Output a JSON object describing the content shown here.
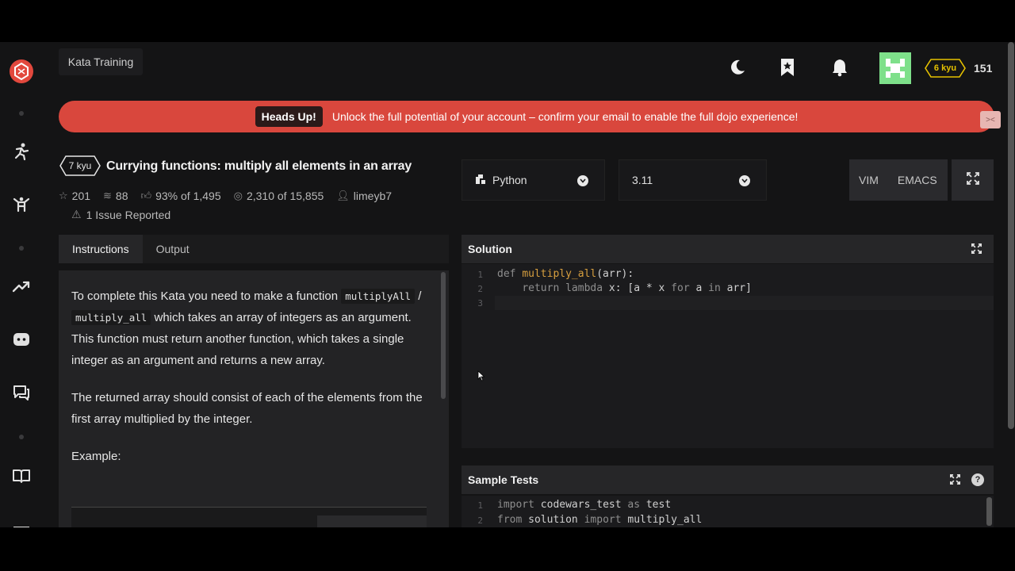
{
  "topbar": {
    "title": "Kata Training",
    "rank": "6 kyu",
    "honor": "151"
  },
  "banner": {
    "badge": "Heads Up!",
    "message": "Unlock the full potential of your account – confirm your email to enable the full dojo experience!",
    "close": "><"
  },
  "kata": {
    "kyu": "7 kyu",
    "title": "Currying functions: multiply all elements in an array",
    "stars": "201",
    "collections": "88",
    "satisfaction": "93% of 1,495",
    "completed": "2,310 of 15,855",
    "author": "limeyb7",
    "issues": "1 Issue Reported"
  },
  "tabs": {
    "instructions": "Instructions",
    "output": "Output"
  },
  "instructions": {
    "p1_start": "To complete this Kata you need to make a function",
    "code1": "multiplyAll",
    "sep": "/",
    "code2": "multiply_all",
    "p1_end": "which takes an array of integers as an argument. This function must return another function, which takes a single integer as an argument and returns a new array.",
    "p2": "The returned array should consist of each of the elements from the first array multiplied by the integer.",
    "p3": "Example:"
  },
  "editor_controls": {
    "language": "Python",
    "version": "3.11",
    "vim": "VIM",
    "emacs": "EMACS"
  },
  "solution": {
    "title": "Solution",
    "lines": [
      "def multiply_all(arr):",
      "    return lambda x: [a * x for a in arr]",
      ""
    ]
  },
  "sample_tests": {
    "title": "Sample Tests",
    "help": "?",
    "lines": [
      "import codewars_test as test",
      "from solution import multiply_all"
    ]
  },
  "colors": {
    "banner": "#d9473d",
    "logo": "#e2483d",
    "rank": "#e6c200",
    "avatar": "#7ee08a"
  }
}
